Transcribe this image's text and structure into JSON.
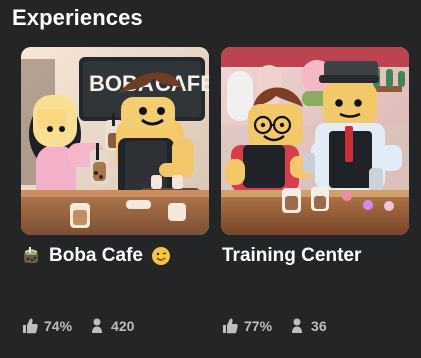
{
  "section": {
    "title": "Experiences"
  },
  "games": [
    {
      "title": "Boba Cafe",
      "title_prefix_icon": "boba-drink-icon",
      "title_suffix_icon": "yum-face-icon",
      "thumbnail_subject": "boba-cafe-thumbnail",
      "thumbnail_sign_text": "BOBA CAFE",
      "like_ratio": "74%",
      "players": "420"
    },
    {
      "title": "Training Center",
      "thumbnail_subject": "training-center-thumbnail",
      "like_ratio": "77%",
      "players": "36"
    }
  ],
  "icons": {
    "thumbs_up": "thumbs-up-icon",
    "player": "player-count-icon"
  },
  "colors": {
    "background": "#232527",
    "text": "#ffffff",
    "meta_text": "#bdbebe"
  }
}
